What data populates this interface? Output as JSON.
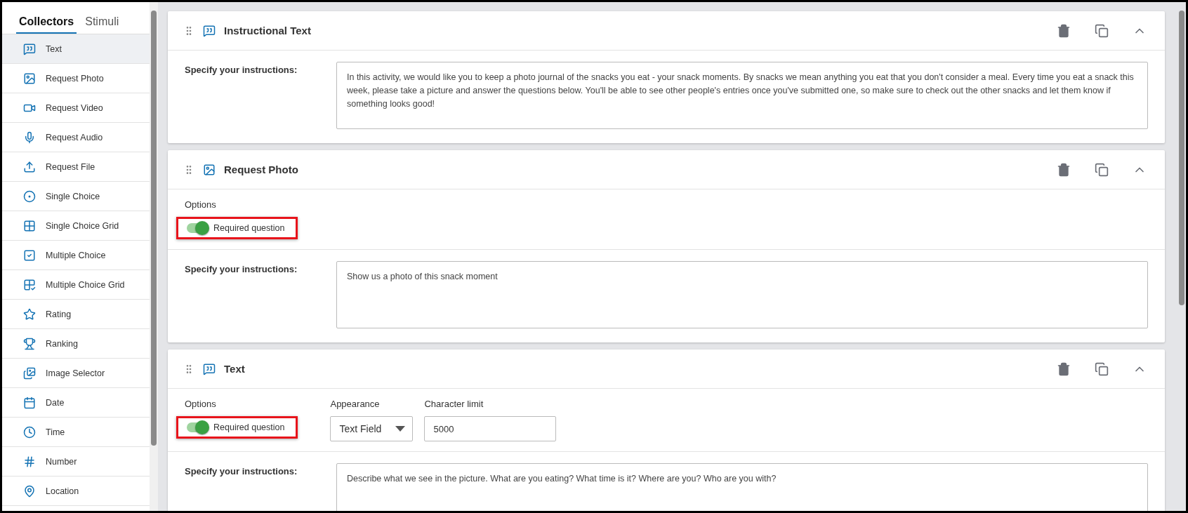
{
  "sidebar": {
    "tabs": [
      {
        "label": "Collectors",
        "selected": true
      },
      {
        "label": "Stimuli",
        "selected": false
      }
    ],
    "items": [
      {
        "label": "Text",
        "selected": true
      },
      {
        "label": "Request Photo",
        "selected": false
      },
      {
        "label": "Request Video",
        "selected": false
      },
      {
        "label": "Request Audio",
        "selected": false
      },
      {
        "label": "Request File",
        "selected": false
      },
      {
        "label": "Single Choice",
        "selected": false
      },
      {
        "label": "Single Choice Grid",
        "selected": false
      },
      {
        "label": "Multiple Choice",
        "selected": false
      },
      {
        "label": "Multiple Choice Grid",
        "selected": false
      },
      {
        "label": "Rating",
        "selected": false
      },
      {
        "label": "Ranking",
        "selected": false
      },
      {
        "label": "Image Selector",
        "selected": false
      },
      {
        "label": "Date",
        "selected": false
      },
      {
        "label": "Time",
        "selected": false
      },
      {
        "label": "Number",
        "selected": false
      },
      {
        "label": "Location",
        "selected": false
      }
    ]
  },
  "cards": [
    {
      "kind": "text",
      "title": "Instructional Text",
      "instructions_label": "Specify your instructions:",
      "instructions": "In this activity, we would like you to keep a photo journal of the snacks you eat - your snack moments. By snacks we mean anything you eat that you don't consider a meal. Every time you eat a snack this week, please take a picture and answer the questions below. You'll be able to see other people's entries once you've submitted one, so make sure to check out the other snacks and let them know if something looks good!"
    },
    {
      "kind": "photo",
      "title": "Request Photo",
      "options": {
        "label": "Options",
        "toggle_label": "Required question",
        "on": true,
        "highlighted": true
      },
      "instructions_label": "Specify your instructions:",
      "instructions": "Show us a photo of this snack moment"
    },
    {
      "kind": "text",
      "title": "Text",
      "options": {
        "label": "Options",
        "toggle_label": "Required question",
        "on": true,
        "highlighted": true
      },
      "appearance": {
        "label": "Appearance",
        "value": "Text Field"
      },
      "character_limit": {
        "label": "Character limit",
        "value": "5000"
      },
      "instructions_label": "Specify your instructions:",
      "instructions": "Describe what we see in the picture. What are you eating? What time is it? Where are you? Who are you with?"
    }
  ]
}
